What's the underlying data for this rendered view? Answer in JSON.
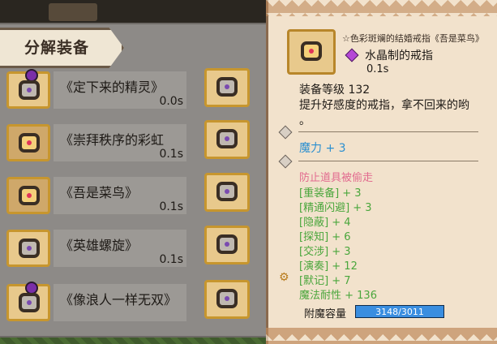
{
  "panel": {
    "title": "分解装备"
  },
  "items": [
    {
      "name": "《定下来的精灵》",
      "time": "0.0s",
      "ring": "gray",
      "orb": true
    },
    {
      "name": "《崇拜秩序的彩虹",
      "time": "0.1s",
      "ring": "gold",
      "orb": false
    },
    {
      "name": "《吾是菜鸟》",
      "time": "0.1s",
      "ring": "gold",
      "orb": false
    },
    {
      "name": "《英雄螺旋》",
      "time": "0.1s",
      "ring": "gray",
      "orb": false
    },
    {
      "name": "《像浪人一样无双》",
      "time": "",
      "ring": "gray",
      "orb": true
    }
  ],
  "tooltip": {
    "name": "☆色彩斑斓的结婚戒指《吾是菜鸟》",
    "subtitle": "水晶制的戒指",
    "subtitle_time": "0.1s",
    "level": "装备等级 132",
    "desc": "提升好感度的戒指，拿不回来的哟",
    "desc2": "。",
    "main_stat": "魔力 + 3",
    "special": "防止道具被偷走",
    "stats": [
      "[重装备] + 3",
      "[精通闪避] + 3",
      "[隐蔽] + 4",
      "[探知] + 6",
      "[交涉] + 3",
      "[演奏] + 12",
      "[默记] + 7",
      "魔法耐性 + 136"
    ],
    "capacity_label": "附魔容量",
    "capacity_value": "3148/3011",
    "capacity_fraction": 1.0
  },
  "colors": {
    "stat_green": "#4aa63c",
    "magic_blue": "#2b8fd0",
    "special_pink": "#e26b8f",
    "bar_blue": "#3a8ee0"
  },
  "icons": {
    "slot": "ring-icon",
    "gem": "crystal-gem-icon",
    "key": "key-icon",
    "bullet": "diamond-bullet-icon"
  }
}
